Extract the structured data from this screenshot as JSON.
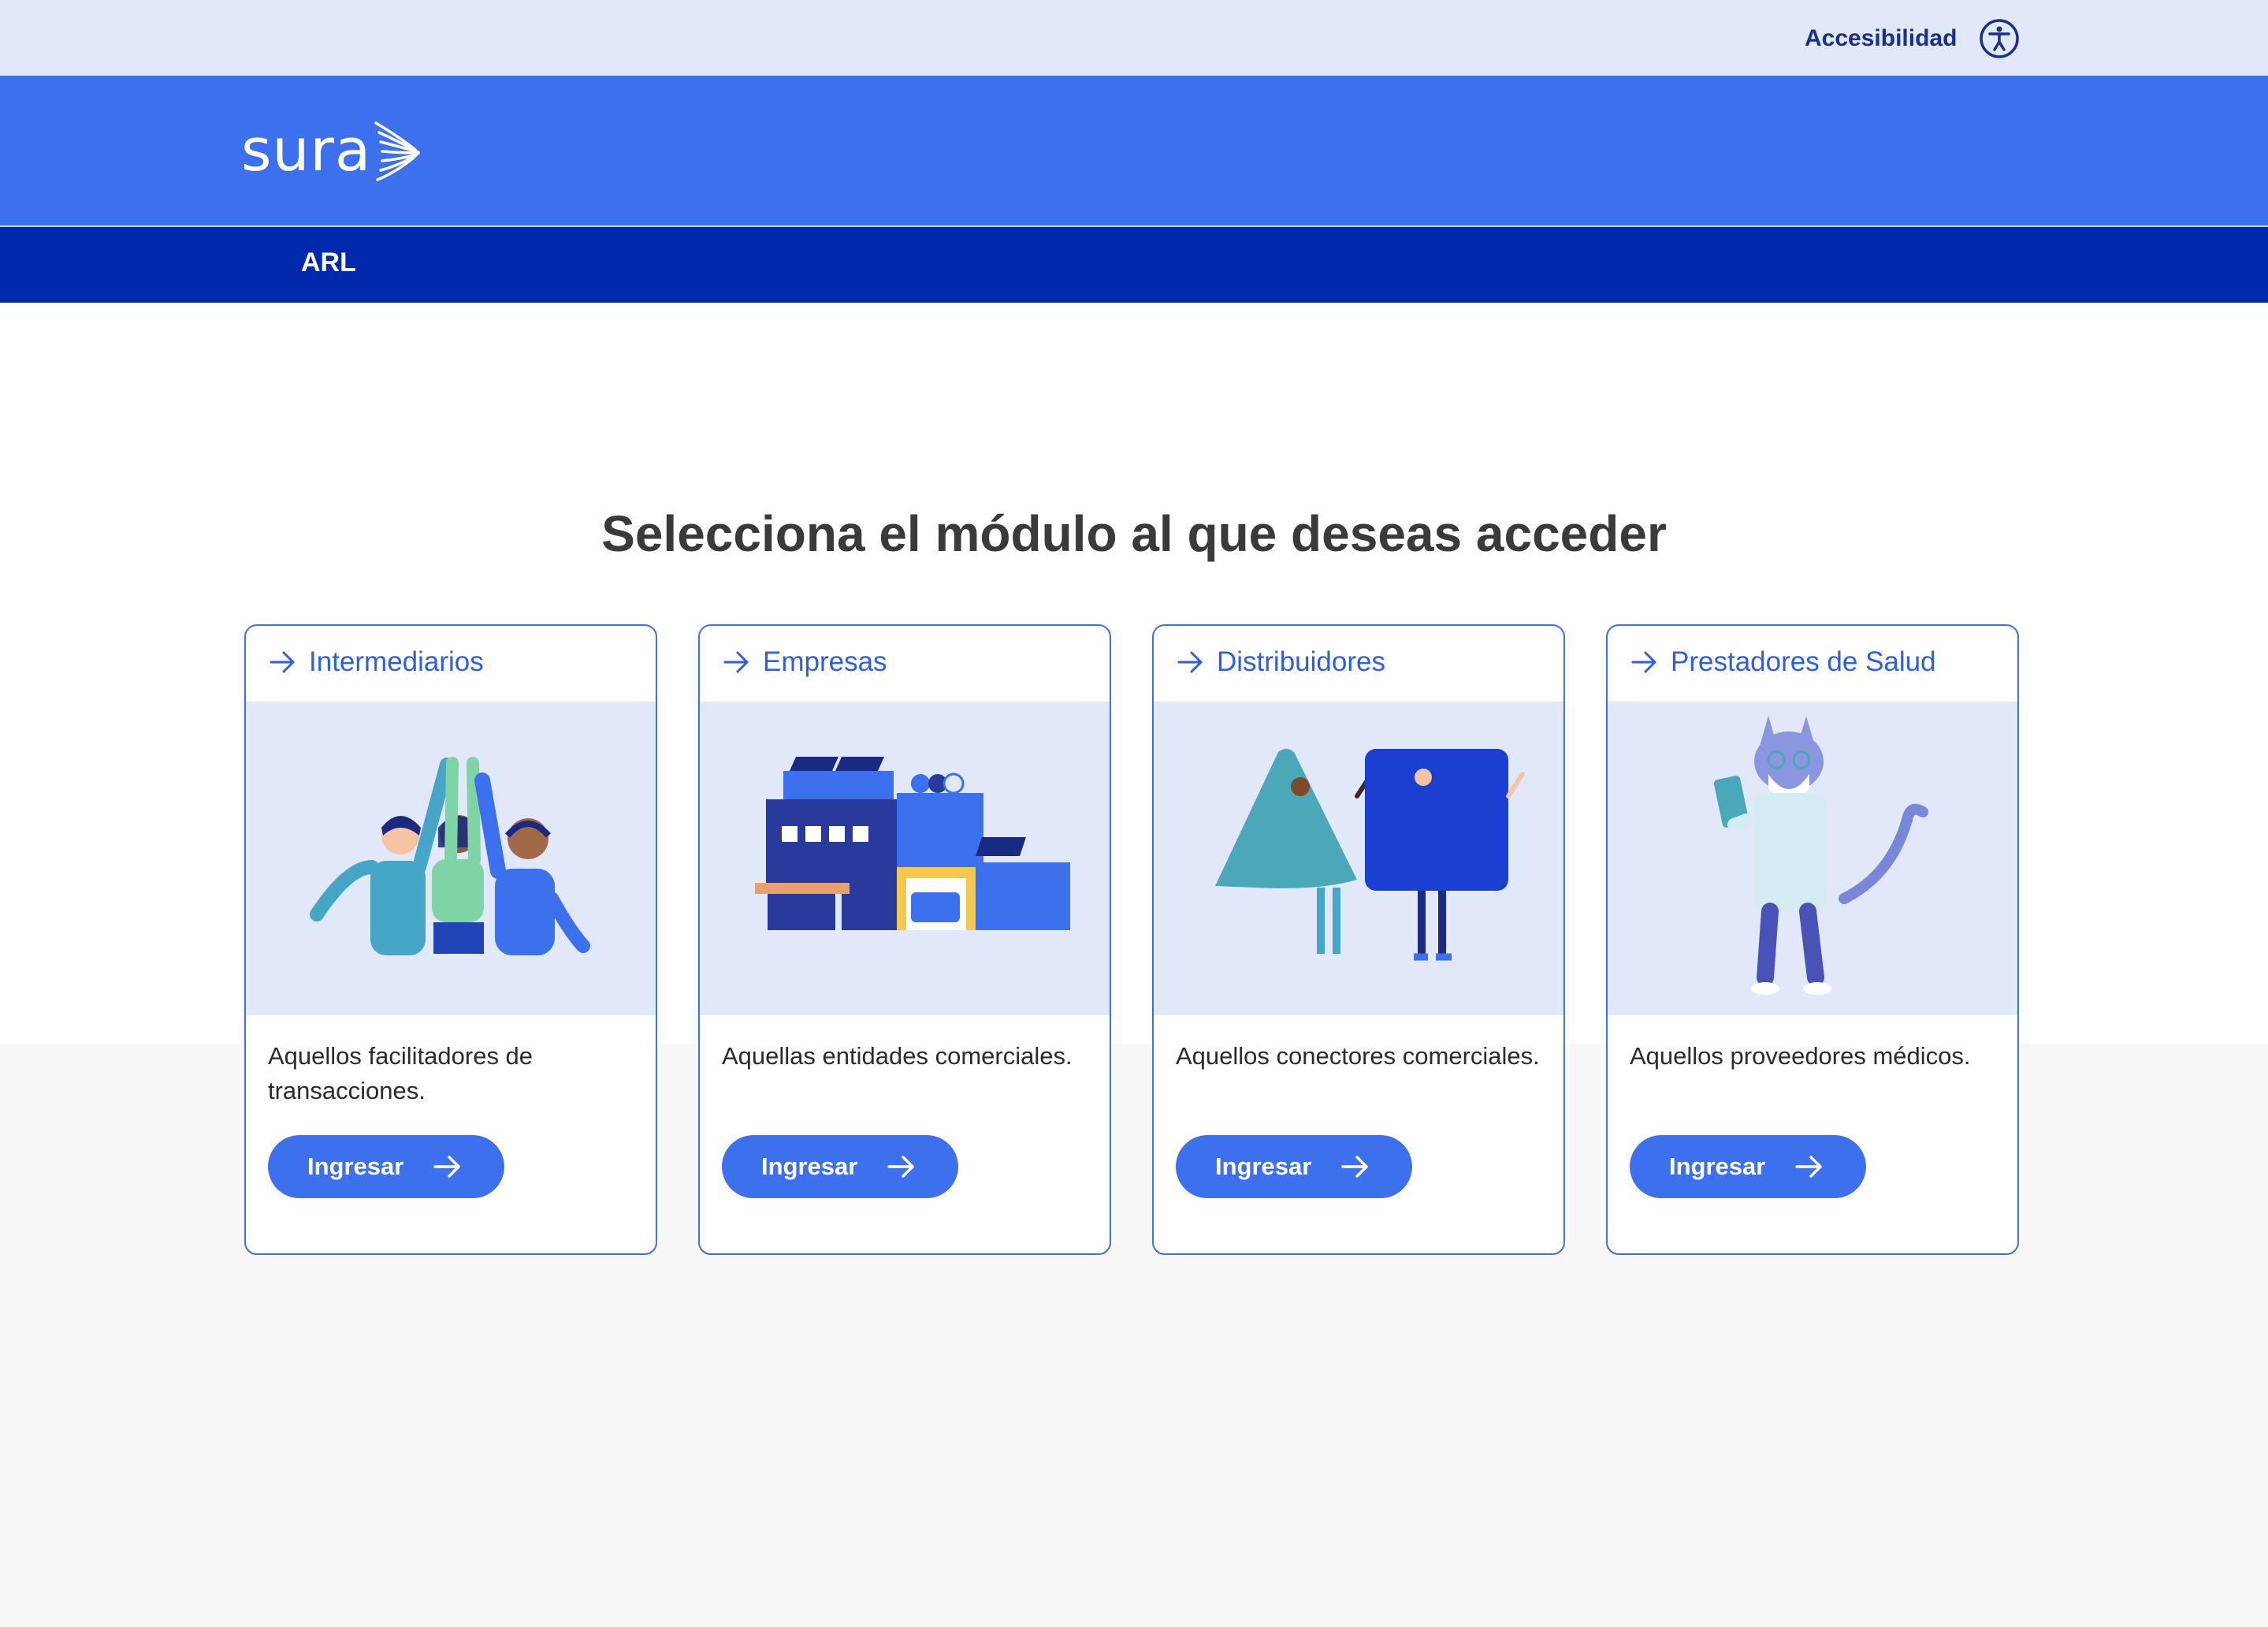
{
  "topbar": {
    "accessibility_label": "Accesibilidad",
    "accessibility_icon": "accessibility-icon"
  },
  "header": {
    "logo_text": "sura"
  },
  "nav": {
    "items": [
      {
        "label": "ARL"
      }
    ]
  },
  "main": {
    "title": "Selecciona el módulo al que deseas acceder",
    "cards": [
      {
        "title": "Intermediarios",
        "description": "Aquellos facilitadores de transacciones.",
        "button_label": "Ingresar",
        "illustration": "people-high-five-illustration"
      },
      {
        "title": "Empresas",
        "description": "Aquellas entidades comerciales.",
        "button_label": "Ingresar",
        "illustration": "company-building-illustration"
      },
      {
        "title": "Distribuidores",
        "description": "Aquellos conectores comerciales.",
        "button_label": "Ingresar",
        "illustration": "costume-shapes-illustration"
      },
      {
        "title": "Prestadores de Salud",
        "description": "Aquellos proveedores médicos.",
        "button_label": "Ingresar",
        "illustration": "cat-doctor-illustration"
      }
    ]
  },
  "colors": {
    "brand_blue": "#3d70ec",
    "nav_dark_blue": "#0029ad",
    "topbar_bg": "#e0e8fa",
    "title_text": "#3a3a3a"
  }
}
